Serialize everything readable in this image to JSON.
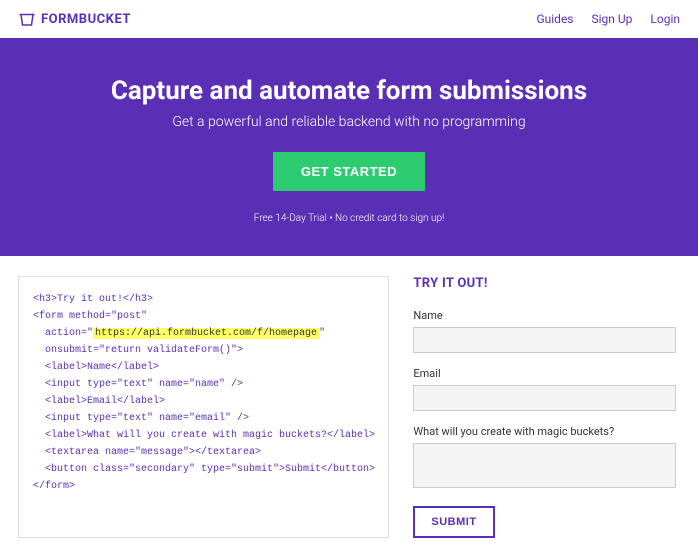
{
  "header": {
    "logo_text": "FORMBUCKET",
    "nav": {
      "guides": "Guides",
      "signup": "Sign Up",
      "login": "Login"
    }
  },
  "hero": {
    "title": "Capture and automate form submissions",
    "subtitle": "Get a powerful and reliable backend with no programming",
    "cta": "GET STARTED",
    "trial": "Free 14-Day Trial • No credit card to sign up!"
  },
  "code": {
    "l1a": "<h3>",
    "l1b": "Try it out!",
    "l1c": "</h3>",
    "l2": "<form method=\"post\"",
    "l3a": "action=\"",
    "l3b": "https://api.formbucket.com/f/homepage",
    "l3c": "\"",
    "l4": "onsubmit=\"return validateForm()\">",
    "l5": "<label>Name</label>",
    "l6": "<input type=\"text\" name=\"name\" />",
    "l7": "<label>Email</label>",
    "l8": "<input type=\"text\" name=\"email\" />",
    "l9": "<label>What will you create with magic buckets?</label>",
    "l10": "<textarea name=\"message\"></textarea>",
    "l11": "<button class=\"secondary\" type=\"submit\">Submit</button>",
    "l12": "</form>"
  },
  "form": {
    "title": "TRY IT OUT!",
    "name_label": "Name",
    "email_label": "Email",
    "message_label": "What will you create with magic buckets?",
    "submit": "SUBMIT"
  }
}
